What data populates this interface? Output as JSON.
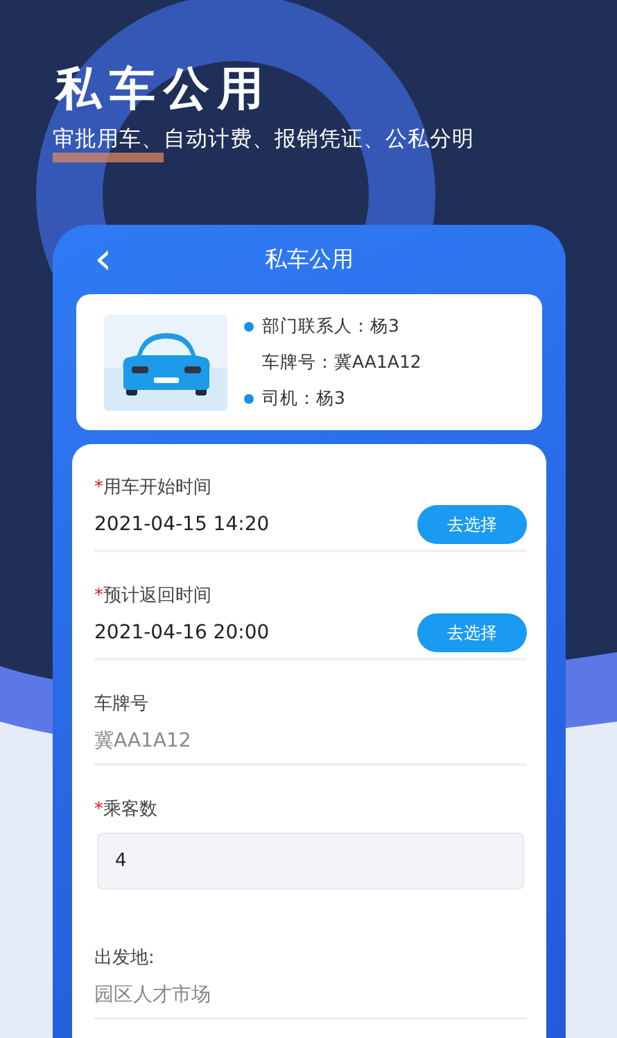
{
  "headline": {
    "title": "私车公用",
    "subtitle": "审批用车、自动计费、报销凭证、公私分明"
  },
  "header": {
    "back": "‹",
    "title": "私车公用"
  },
  "vehicle_card": {
    "details": [
      {
        "text": "部门联系人：杨3",
        "bullet": true
      },
      {
        "text": "车牌号：冀AA1A12",
        "bullet": false
      },
      {
        "text": "司机：杨3",
        "bullet": true
      }
    ]
  },
  "form": {
    "required_mark": "*",
    "fields": [
      {
        "kind": "picker",
        "label": "用车开始时间",
        "required": true,
        "value": "2021-04-15 14:20",
        "button": "去选择"
      },
      {
        "kind": "picker",
        "label": "预计返回时间",
        "required": true,
        "value": "2021-04-16 20:00",
        "button": "去选择"
      },
      {
        "kind": "text",
        "label": "车牌号",
        "required": false,
        "value": "冀AA1A12"
      },
      {
        "kind": "input",
        "label": "乘客数",
        "required": true,
        "value": "4"
      },
      {
        "kind": "text",
        "label": "出发地:",
        "required": false,
        "value": "园区人才市场"
      }
    ]
  }
}
